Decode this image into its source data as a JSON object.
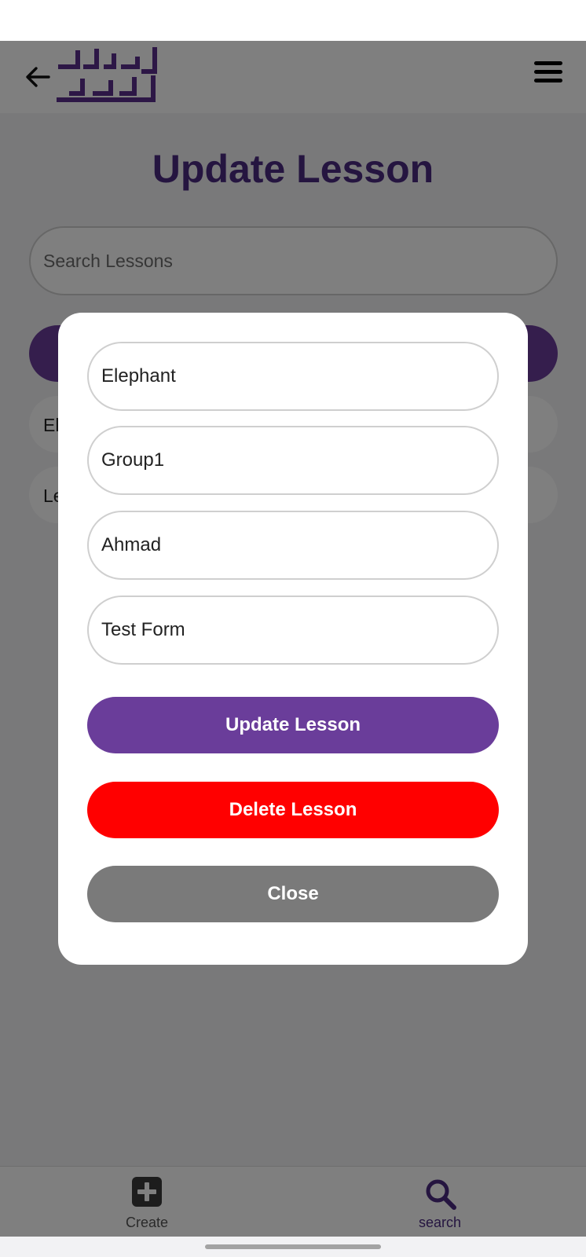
{
  "header": {
    "logo_text": "شطرنج القدس",
    "back_icon": "arrow-left-icon",
    "menu_icon": "hamburger-menu-icon"
  },
  "page": {
    "title": "Update Lesson",
    "search_placeholder": "Search Lessons"
  },
  "results": [
    {
      "label": "El"
    },
    {
      "label": "Le"
    }
  ],
  "modal": {
    "fields": [
      {
        "value": "Elephant"
      },
      {
        "value": "Group1"
      },
      {
        "value": "Ahmad"
      },
      {
        "value": "Test Form"
      }
    ],
    "update_label": "Update Lesson",
    "delete_label": "Delete Lesson",
    "close_label": "Close"
  },
  "bottom_nav": {
    "create_label": "Create",
    "create_icon": "plus-square-icon",
    "search_label": "search",
    "search_icon": "search-icon"
  },
  "colors": {
    "primary": "#6a3d9a",
    "title": "#4a2a80",
    "danger": "#ff0000",
    "neutral": "#7a7a7a"
  }
}
